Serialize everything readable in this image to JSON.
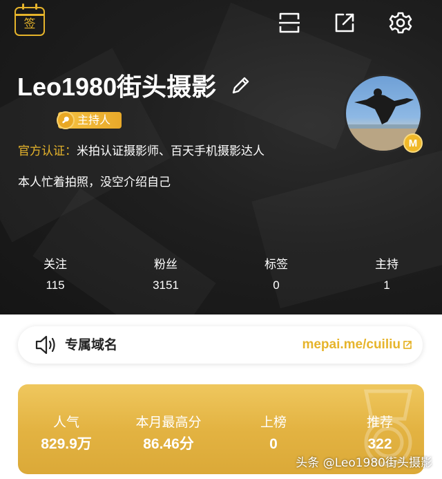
{
  "header": {
    "sign_label": "签",
    "icons": [
      "scan-icon",
      "share-icon",
      "gear-icon"
    ]
  },
  "profile": {
    "username": "Leo1980街头摄影",
    "badge_label": "主持人",
    "official_label": "官方认证：",
    "official_value": "米拍认证摄影师、百天手机摄影达人",
    "bio": "本人忙着拍照，没空介绍自己",
    "avatar_badge": "M"
  },
  "stats": [
    {
      "label": "关注",
      "value": "115"
    },
    {
      "label": "粉丝",
      "value": "3151"
    },
    {
      "label": "标签",
      "value": "0"
    },
    {
      "label": "主持",
      "value": "1"
    }
  ],
  "domain": {
    "title": "专属域名",
    "link": "mepai.me/cuiliu"
  },
  "scores": [
    {
      "label": "人气",
      "value": "829.9万"
    },
    {
      "label": "本月最高分",
      "value": "86.46分"
    },
    {
      "label": "上榜",
      "value": "0"
    },
    {
      "label": "推荐",
      "value": "322"
    }
  ],
  "watermark": "头条 @Leo1980街头摄影",
  "colors": {
    "accent": "#e6b42b",
    "hero_bg": "#1e1e1e",
    "card_gold": "#e3b342"
  }
}
